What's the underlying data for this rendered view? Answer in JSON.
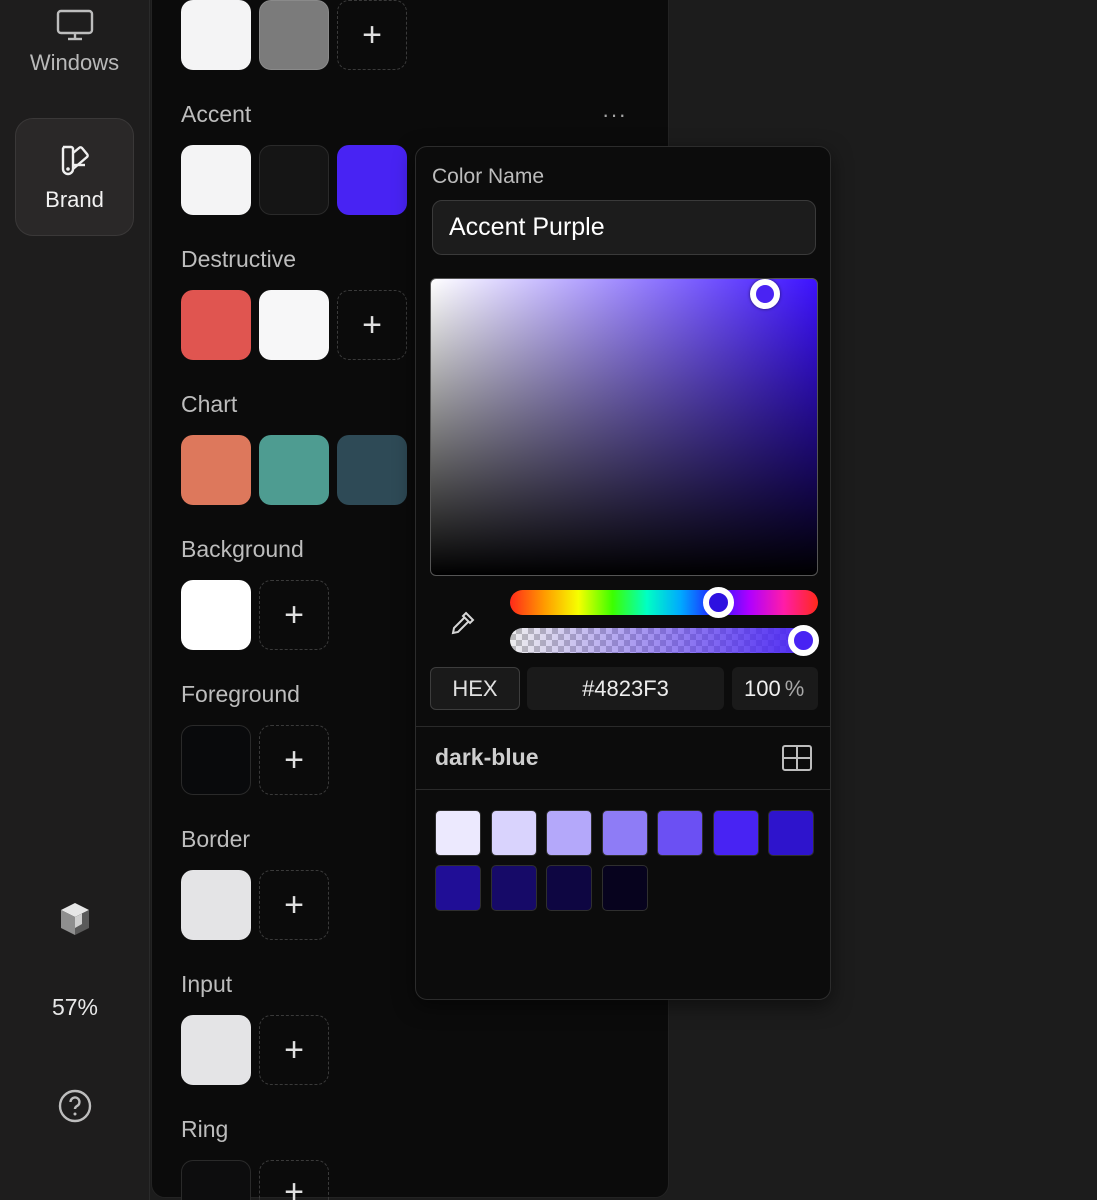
{
  "nav": {
    "windows_label": "Windows",
    "brand_label": "Brand",
    "zoom": "57%"
  },
  "palette": {
    "groups": [
      {
        "label": "",
        "swatches": [
          "#f4f4f5",
          "#7b7b7b"
        ],
        "add": true
      },
      {
        "label": "Accent",
        "swatches": [
          "#f4f4f5",
          "#151515",
          "#4823f3"
        ],
        "add": false
      },
      {
        "label": "Destructive",
        "swatches": [
          "#e05550",
          "#f7f7f8"
        ],
        "add": true
      },
      {
        "label": "Chart",
        "swatches": [
          "#dd785c",
          "#4e9c91",
          "#2e4a56"
        ],
        "add": false
      },
      {
        "label": "Background",
        "swatches": [
          "#ffffff"
        ],
        "add": true
      },
      {
        "label": "Foreground",
        "swatches": [
          "#090a0c"
        ],
        "add": true
      },
      {
        "label": "Border",
        "swatches": [
          "#e4e4e6"
        ],
        "add": true
      },
      {
        "label": "Input",
        "swatches": [
          "#e4e4e6"
        ],
        "add": true
      },
      {
        "label": "Ring",
        "swatches": [
          "#0d0d0e"
        ],
        "add": true
      }
    ],
    "more_label": "···",
    "add_glyph": "+"
  },
  "picker": {
    "color_name_label": "Color Name",
    "color_name_value": "Accent Purple",
    "mode_label": "HEX",
    "hex_value": "#4823F3",
    "opacity_value": "100",
    "opacity_unit": "%",
    "scale_name": "dark-blue",
    "saturation": 0.86,
    "brightness": 0.95,
    "hue_position": 0.68,
    "alpha": 1.0,
    "scale_swatches": [
      "#ece9fe",
      "#d9d3fd",
      "#b4a8fa",
      "#8e7cf6",
      "#6b50f3",
      "#4823f3",
      "#2e14cc",
      "#200e96",
      "#160a68",
      "#0e0642",
      "#07031e"
    ]
  }
}
